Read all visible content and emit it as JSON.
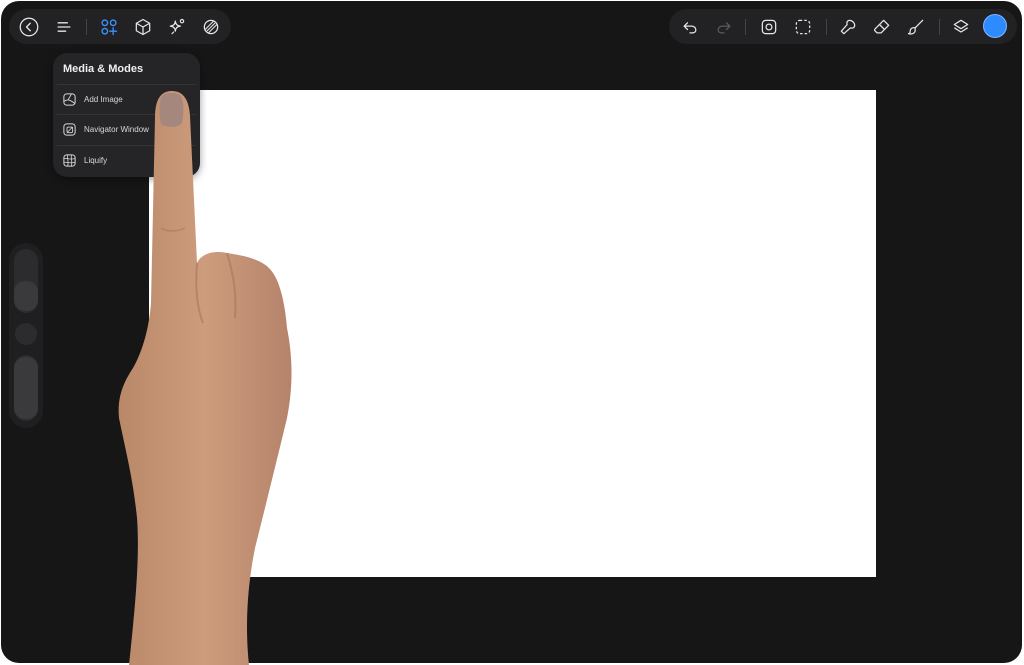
{
  "toolbar_left": {
    "buttons": [
      {
        "name": "back-button",
        "icon": "chevron-left-icon"
      },
      {
        "name": "gallery-menu-button",
        "icon": "menu-lines-icon"
      },
      {
        "name": "media-modes-button",
        "icon": "shapes-plus-icon",
        "active": true
      },
      {
        "name": "3d-button",
        "icon": "cube-icon"
      },
      {
        "name": "effects-button",
        "icon": "sparkle-icon"
      },
      {
        "name": "symmetry-button",
        "icon": "overlap-circles-icon"
      }
    ]
  },
  "toolbar_right": {
    "buttons": [
      {
        "name": "undo-button",
        "icon": "undo-icon"
      },
      {
        "name": "redo-button",
        "icon": "redo-icon",
        "disabled": true
      },
      {
        "name": "transform-button",
        "icon": "transform-icon"
      },
      {
        "name": "selection-button",
        "icon": "dashed-selection-icon"
      },
      {
        "name": "smudge-button",
        "icon": "smudge-icon"
      },
      {
        "name": "eraser-button",
        "icon": "eraser-icon"
      },
      {
        "name": "brush-button",
        "icon": "brush-icon"
      },
      {
        "name": "layers-button",
        "icon": "layers-icon"
      }
    ],
    "active_color": "#2e8bff"
  },
  "menu": {
    "title": "Media & Modes",
    "items": [
      {
        "label": "Add Image",
        "icon": "add-image-icon"
      },
      {
        "label": "Navigator Window",
        "icon": "navigator-icon"
      },
      {
        "label": "Liquify",
        "icon": "liquify-grid-icon"
      }
    ]
  },
  "colors": {
    "background": "#161616",
    "canvas": "#ffffff",
    "toolbar": "#222224",
    "accent": "#2e8bff"
  }
}
